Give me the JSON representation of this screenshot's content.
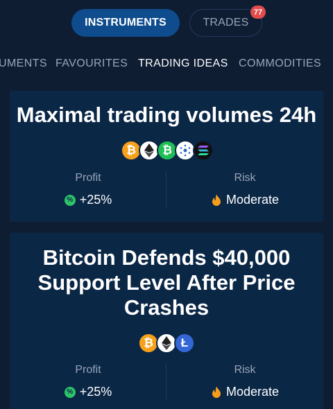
{
  "top_tabs": {
    "instruments": "INSTRUMENTS",
    "trades": "TRADES",
    "trades_badge": "77"
  },
  "categories": [
    "UMENTS",
    "FAVOURITES",
    "TRADING IDEAS",
    "COMMODITIES"
  ],
  "active_category": "TRADING IDEAS",
  "cards": [
    {
      "title": "Maximal trading volumes 24h",
      "coins": [
        "bitcoin-icon",
        "ethereum-icon",
        "bitcoin-cash-icon",
        "cardano-icon",
        "solana-icon"
      ],
      "profit_label": "Profit",
      "profit_value": "+25%",
      "risk_label": "Risk",
      "risk_value": "Moderate"
    },
    {
      "title": "Bitcoin Defends $40,000 Support Level After Price Crashes",
      "coins": [
        "bitcoin-icon",
        "ethereum-icon",
        "litecoin-icon"
      ],
      "profit_label": "Profit",
      "profit_value": "+25%",
      "risk_label": "Risk",
      "risk_value": "Moderate"
    }
  ],
  "colors": {
    "background": "#0f1d33",
    "card": "#0b2746",
    "accent": "#0e4c8e",
    "badge": "#e34c4c",
    "profit": "#2ec26a",
    "risk": "#f59e1b"
  }
}
